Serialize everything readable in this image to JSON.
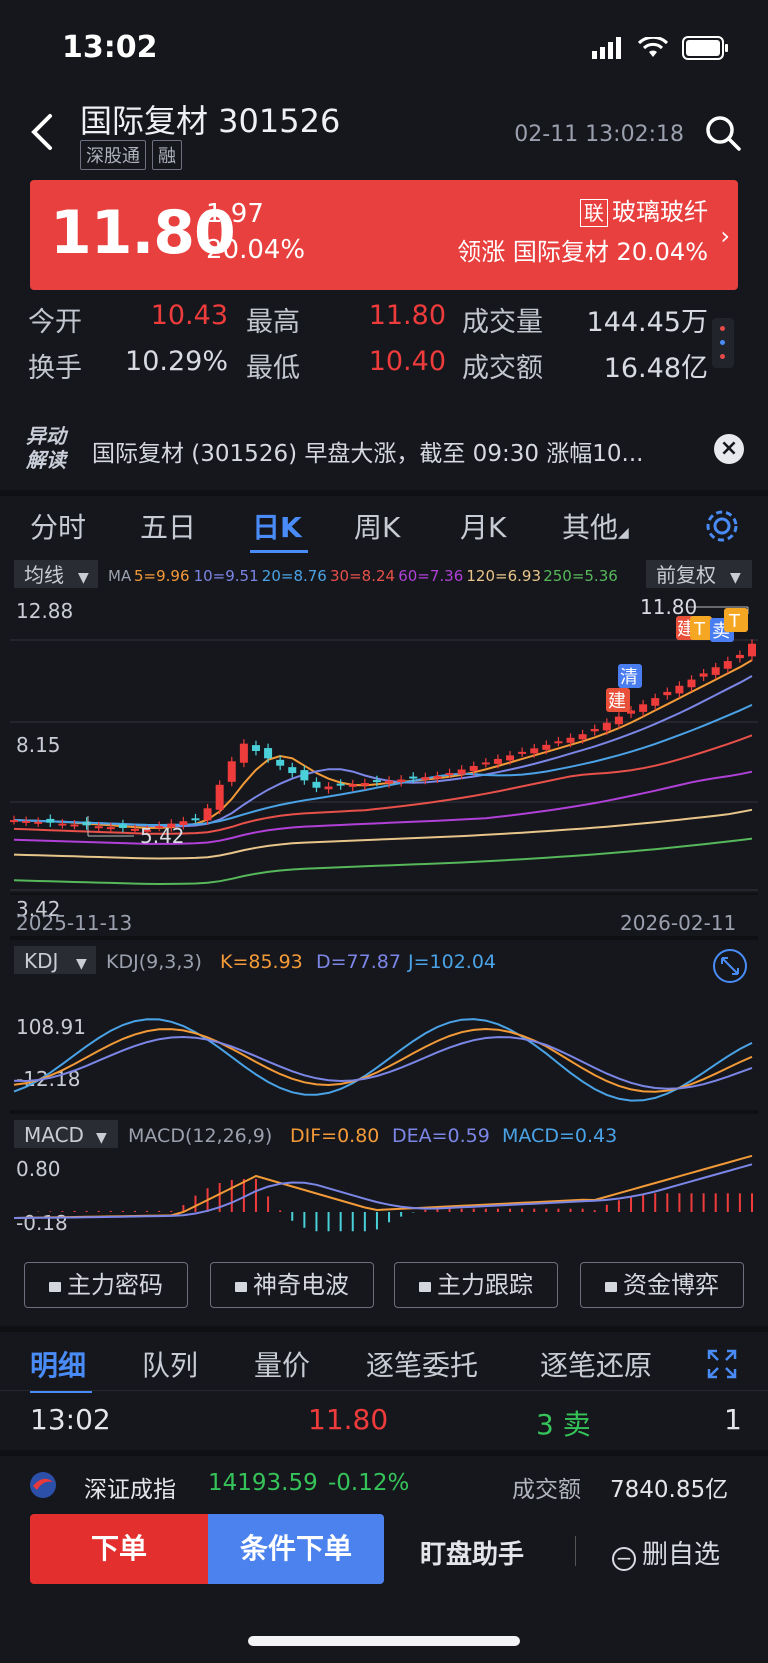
{
  "status_bar": {
    "time": "13:02"
  },
  "header": {
    "title": "国际复材 301526",
    "tags": [
      "深股通",
      "融"
    ],
    "timestamp": "02-11 13:02:18"
  },
  "quote": {
    "price": "11.80",
    "change": "1.97",
    "change_pct": "20.04%",
    "sector_badge": "联",
    "sector_name": "玻璃玻纤",
    "leader_label": "领涨",
    "leader_name": "国际复材",
    "leader_pct": "20.04%"
  },
  "stats": {
    "open_label": "今开",
    "open": "10.43",
    "high_label": "最高",
    "high": "11.80",
    "volume_label": "成交量",
    "volume": "144.45万",
    "turnover_label": "换手",
    "turnover": "10.29%",
    "low_label": "最低",
    "low": "10.40",
    "amount_label": "成交额",
    "amount": "16.48亿"
  },
  "news": {
    "logo_line1": "异动",
    "logo_line2": "解读",
    "text": "国际复材 (301526) 早盘大涨，截至 09:30 涨幅10...",
    "close": "×"
  },
  "period_tabs": [
    "分时",
    "五日",
    "日K",
    "周K",
    "月K",
    "其他"
  ],
  "active_period": "日K",
  "ma_panel": {
    "dropdown": "均线",
    "prefix": "MA",
    "items": [
      {
        "label": "5=9.96",
        "color": "#f29a38"
      },
      {
        "label": "10=9.51",
        "color": "#7b86e6"
      },
      {
        "label": "20=8.76",
        "color": "#4aa3e6"
      },
      {
        "label": "30=8.24",
        "color": "#e8504a"
      },
      {
        "label": "60=7.36",
        "color": "#b040d8"
      },
      {
        "label": "120=6.93",
        "color": "#e8c58a"
      },
      {
        "label": "250=5.36",
        "color": "#56b85a"
      }
    ],
    "adjust": "前复权",
    "y_top": "12.88",
    "y_mid": "8.15",
    "y_bottom": "3.42",
    "max_label": "11.80",
    "min_label": "5.42",
    "date_start": "2025-11-13",
    "date_end": "2026-02-11",
    "markers": [
      "清",
      "建",
      "建",
      "T",
      "卖",
      "T"
    ]
  },
  "kdj_panel": {
    "dropdown": "KDJ",
    "params": "KDJ(9,3,3)",
    "k": "K=85.93",
    "d": "D=77.87",
    "j": "J=102.04",
    "y_top": "108.91",
    "y_bottom": "-12.18"
  },
  "macd_panel": {
    "dropdown": "MACD",
    "params": "MACD(12,26,9)",
    "dif": "DIF=0.80",
    "dea": "DEA=0.59",
    "macd": "MACD=0.43",
    "y_top": "0.80",
    "y_bottom": "-0.18"
  },
  "tools": [
    "主力密码",
    "神奇电波",
    "主力跟踪",
    "资金博弈"
  ],
  "detail_tabs": [
    "明细",
    "队列",
    "量价",
    "逐笔委托",
    "逐笔还原"
  ],
  "trade": {
    "time": "13:02",
    "price": "11.80",
    "side": "3 卖",
    "count": "1"
  },
  "index": {
    "name": "深证成指",
    "value": "14193.59",
    "change": "-0.12%",
    "amount_label": "成交额",
    "amount": "7840.85亿"
  },
  "actions": {
    "order": "下单",
    "conditional": "条件下单",
    "assistant": "盯盘助手",
    "remove": "删自选"
  },
  "colors": {
    "up": "#ee3b3b",
    "down": "#35c35a",
    "accent": "#4a8cf7",
    "banner": "#e8403f"
  }
}
